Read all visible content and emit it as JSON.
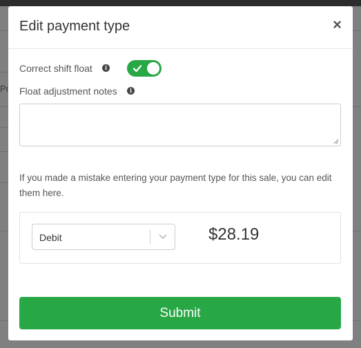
{
  "modal": {
    "title": "Edit payment type",
    "close_label": "×"
  },
  "form": {
    "correct_shift_float_label": "Correct shift float",
    "correct_shift_float_on": true,
    "float_notes_label": "Float adjustment notes",
    "float_notes_value": "",
    "help_text": "If you made a mistake entering your payment type for this sale, you can edit them here."
  },
  "payment": {
    "type_selected": "Debit",
    "amount": "$28.19"
  },
  "actions": {
    "submit_label": "Submit"
  },
  "background": {
    "partial_text": "Pr"
  },
  "colors": {
    "accent": "#28a745",
    "overlay": "#808080"
  },
  "icons": {
    "info": "info-icon",
    "close": "close-icon",
    "check": "check-icon",
    "chevron": "chevron-down-icon"
  }
}
